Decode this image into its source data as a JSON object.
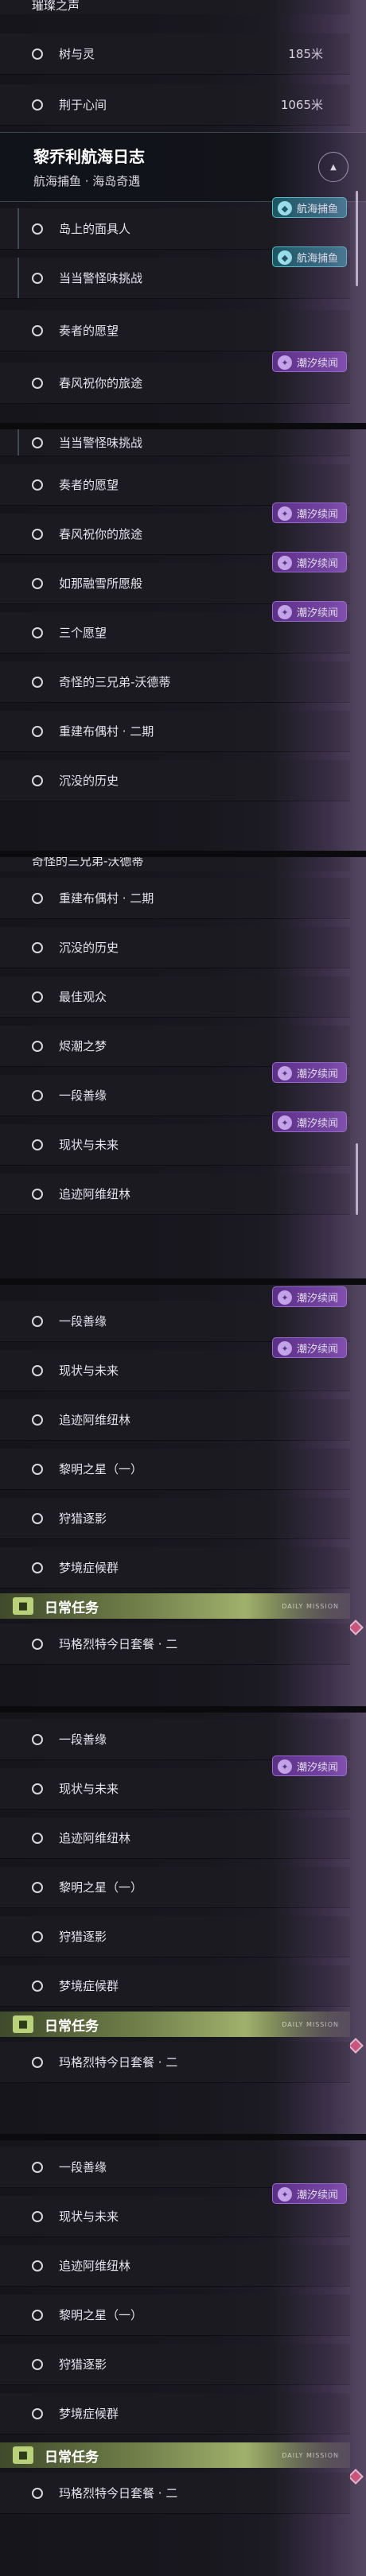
{
  "colors": {
    "badge_purple": "#7a3fb0",
    "badge_teal": "#2a7a86",
    "daily_green": "#a0b06c",
    "alert_red": "#e0405e"
  },
  "s1": {
    "top_partial": "璀璨之声",
    "rows": [
      {
        "label": "树与灵",
        "dist": "185米"
      },
      {
        "label": "荆于心间",
        "dist": "1065米"
      }
    ],
    "quest": {
      "title": "黎乔利航海日志",
      "subtitle": "航海捕鱼 · 海岛奇遇",
      "toggle": "▲"
    },
    "sub_rows": [
      "岛上的面具人",
      "当当警怪味挑战"
    ],
    "badge_teal": "航海捕鱼",
    "rows2": [
      "奏者的愿望",
      "春风祝你的旅途"
    ],
    "badge_purple": "潮汐续闻"
  },
  "s2": {
    "rows": [
      "当当警怪味挑战",
      "奏者的愿望",
      "春风祝你的旅途",
      "如那融雪所愿般",
      "三个愿望",
      "奇怪的三兄弟-沃德蒂",
      "重建布偶村 · 二期",
      "沉没的历史"
    ],
    "badge": "潮汐续闻"
  },
  "s3": {
    "top_partial": "奇怪的三兄弟-沃德蒂",
    "rows": [
      "重建布偶村 · 二期",
      "沉没的历史",
      "最佳观众",
      "烬潮之梦",
      "一段善缘",
      "现状与未来",
      "追迹阿维纽林"
    ],
    "badge": "潮汐续闻"
  },
  "s4": {
    "rows": [
      "一段善缘",
      "现状与未来",
      "追迹阿维纽林",
      "黎明之星（一）",
      "狩猎逐影",
      "梦境症候群"
    ],
    "badge": "潮汐续闻",
    "daily": {
      "label": "日常任务",
      "small": "DAILY MISSION"
    },
    "daily_row": "玛格烈特今日套餐 · 二"
  },
  "s5": {
    "rows": [
      "一段善缘",
      "现状与未来",
      "追迹阿维纽林",
      "黎明之星（一）",
      "狩猎逐影",
      "梦境症候群"
    ],
    "badge": "潮汐续闻",
    "daily": {
      "label": "日常任务",
      "small": "DAILY MISSION"
    },
    "daily_row": "玛格烈特今日套餐 · 二"
  },
  "s6": {
    "rows": [
      "一段善缘",
      "现状与未来",
      "追迹阿维纽林",
      "黎明之星（一）",
      "狩猎逐影",
      "梦境症候群"
    ],
    "badge": "潮汐续闻",
    "daily": {
      "label": "日常任务",
      "small": "DAILY MISSION"
    },
    "daily_row": "玛格烈特今日套餐 · 二"
  }
}
